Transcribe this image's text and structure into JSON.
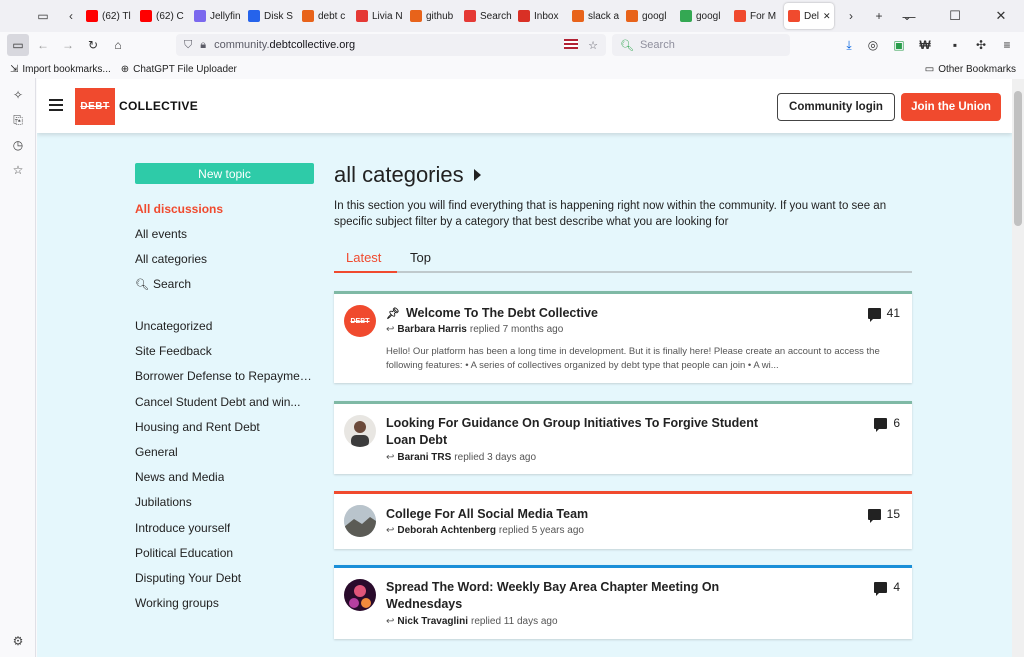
{
  "browser": {
    "tabs": [
      {
        "label": "(62) Tl",
        "color": "#ff0000"
      },
      {
        "label": "(62) C",
        "color": "#ff0000"
      },
      {
        "label": "Jellyfin",
        "color": "#7b68ee"
      },
      {
        "label": "Disk S",
        "color": "#2563eb"
      },
      {
        "label": "debt c",
        "color": "#e8631a"
      },
      {
        "label": "Livia N",
        "color": "#e53935"
      },
      {
        "label": "github",
        "color": "#e8631a"
      },
      {
        "label": "Search",
        "color": "#e53935"
      },
      {
        "label": "Inbox",
        "color": "#d93025"
      },
      {
        "label": "slack a",
        "color": "#e8631a"
      },
      {
        "label": "googl",
        "color": "#e8631a"
      },
      {
        "label": "googl",
        "color": "#34a853"
      },
      {
        "label": "For M",
        "color": "#f04a2e"
      },
      {
        "label": "Del",
        "color": "#f04a2e",
        "active": true
      }
    ],
    "url_prefix": "community.",
    "url_domain": "debtcollective.org",
    "search_placeholder": "Search",
    "bookmarks": [
      "Import bookmarks...",
      "ChatGPT File Uploader"
    ],
    "other_bookmarks": "Other Bookmarks"
  },
  "header": {
    "logo_box": "DEBT",
    "logo_text": "COLLECTIVE",
    "login_label": "Community login",
    "join_label": "Join the Union"
  },
  "sidebar": {
    "new_topic": "New topic",
    "primary": [
      "All discussions",
      "All events",
      "All categories",
      "Search"
    ],
    "categories": [
      "Uncategorized",
      "Site Feedback",
      "Borrower Defense to Repaymen...",
      "Cancel Student Debt and win...",
      "Housing and Rent Debt",
      "General",
      "News and Media",
      "Jubilations",
      "Introduce yourself",
      "Political Education",
      "Disputing Your Debt",
      "Working groups"
    ]
  },
  "main": {
    "title": "all categories",
    "description": "In this section you will find everything that is happening right now within the community. If you want to see an specific subject filter by a category that best describe what you are looking for",
    "tabs": [
      "Latest",
      "Top"
    ],
    "topics": [
      {
        "title": "Welcome To The Debt Collective",
        "author": "Barbara Harris",
        "replied": "replied 7 months ago",
        "replies": "41",
        "excerpt": "Hello! Our platform has been a long time in development. But it is finally here! Please create an account to access the following features: • A series of collectives organized by debt type that people can join • A wi...",
        "bar_color": "#7fb9a5",
        "pinned": true
      },
      {
        "title": "Looking For Guidance On Group Initiatives To Forgive Student Loan Debt",
        "author": "Barani TRS",
        "replied": "replied 3 days ago",
        "replies": "6",
        "bar_color": "#7fb9a5"
      },
      {
        "title": "College For All Social Media Team",
        "author": "Deborah Achtenberg",
        "replied": "replied 5 years ago",
        "replies": "15",
        "bar_color": "#f04a2e"
      },
      {
        "title": "Spread The Word: Weekly Bay Area Chapter Meeting On Wednesdays",
        "author": "Nick Travaglini",
        "replied": "replied 11 days ago",
        "replies": "4",
        "bar_color": "#1a8fd8"
      }
    ]
  },
  "colors": {
    "brand": "#f04a2e",
    "new_topic": "#2ecba8",
    "page_bg": "#e5f7fc"
  }
}
